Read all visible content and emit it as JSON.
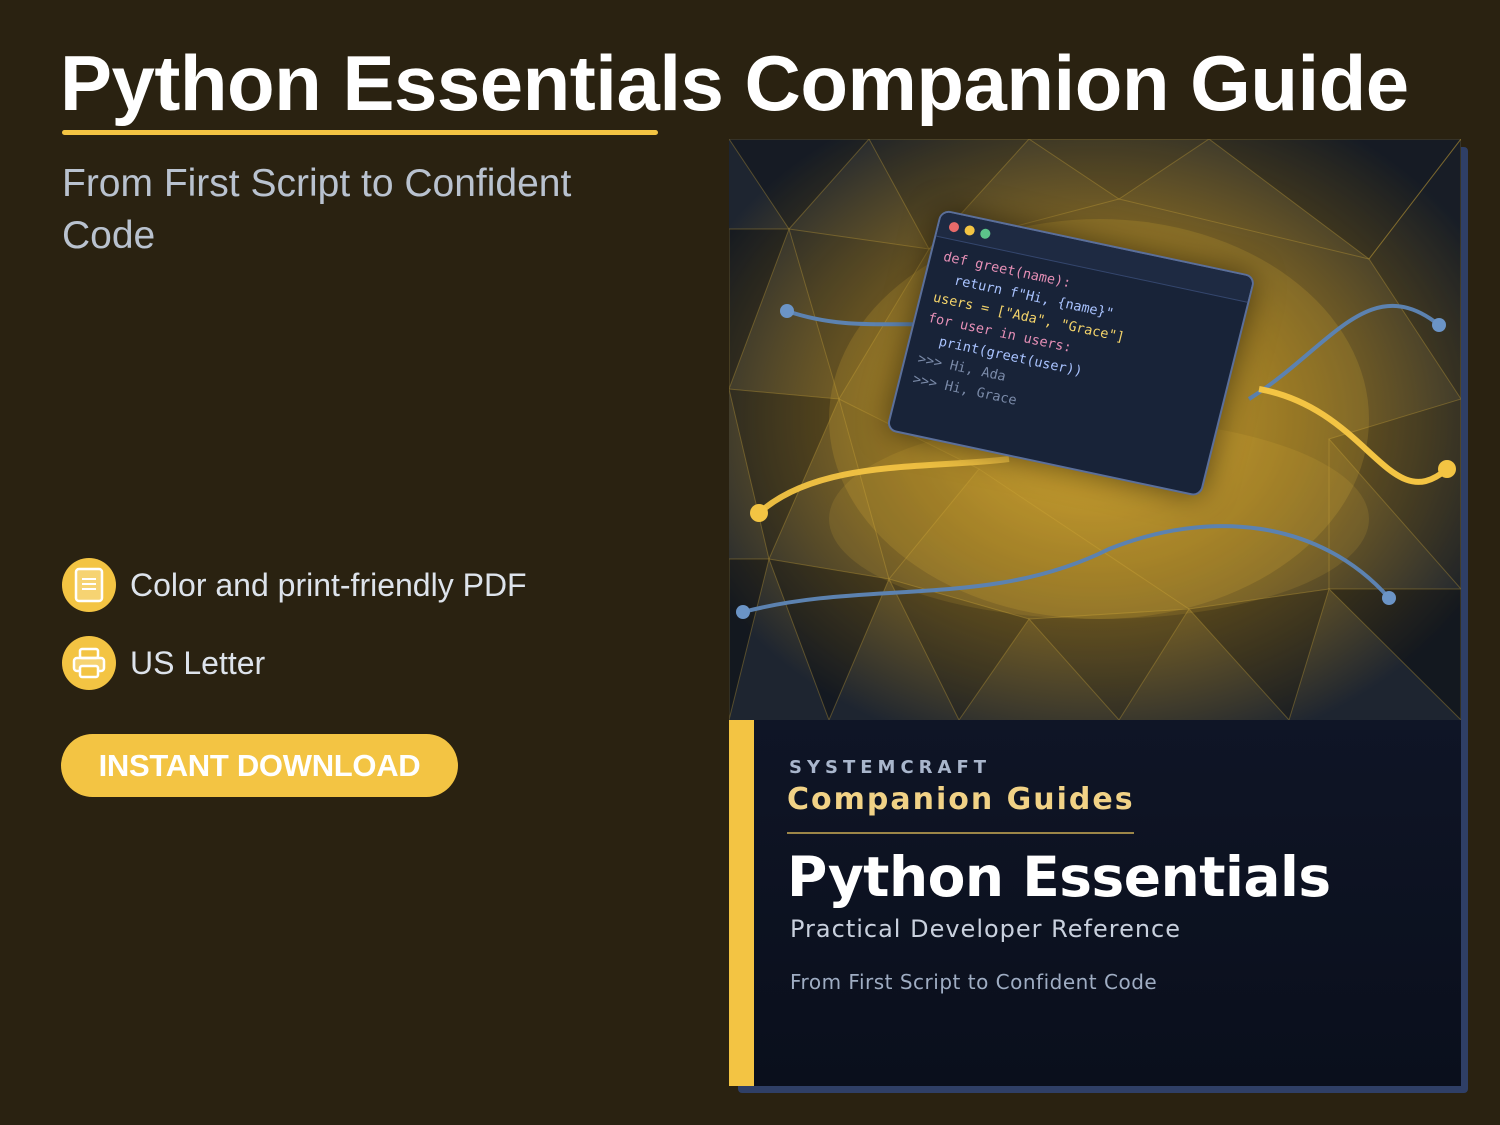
{
  "header": {
    "title": "Python Essentials Companion Guide",
    "subtitle": "From First Script to Confident Code"
  },
  "features": [
    {
      "icon": "document-icon",
      "label": "Color and print-friendly PDF"
    },
    {
      "icon": "printer-icon",
      "label": "US Letter"
    }
  ],
  "cta": {
    "label": "INSTANT DOWNLOAD"
  },
  "book": {
    "brand": "SYSTEMCRAFT",
    "series": "Companion Guides",
    "title": "Python Essentials",
    "subtitle": "Practical Developer Reference",
    "tagline": "From First Script to Confident Code",
    "code_lines": [
      "def greet(name):",
      "  return f\"Hi, {name}\"",
      "users = [\"Ada\", \"Grace\"]",
      "for user in users:",
      "  print(greet(user))",
      ">>> Hi, Ada",
      ">>> Hi, Grace"
    ]
  },
  "colors": {
    "background": "#2a2211",
    "accent": "#f3c443",
    "cover_dark": "#0c1120",
    "series_text": "#f1d286"
  }
}
